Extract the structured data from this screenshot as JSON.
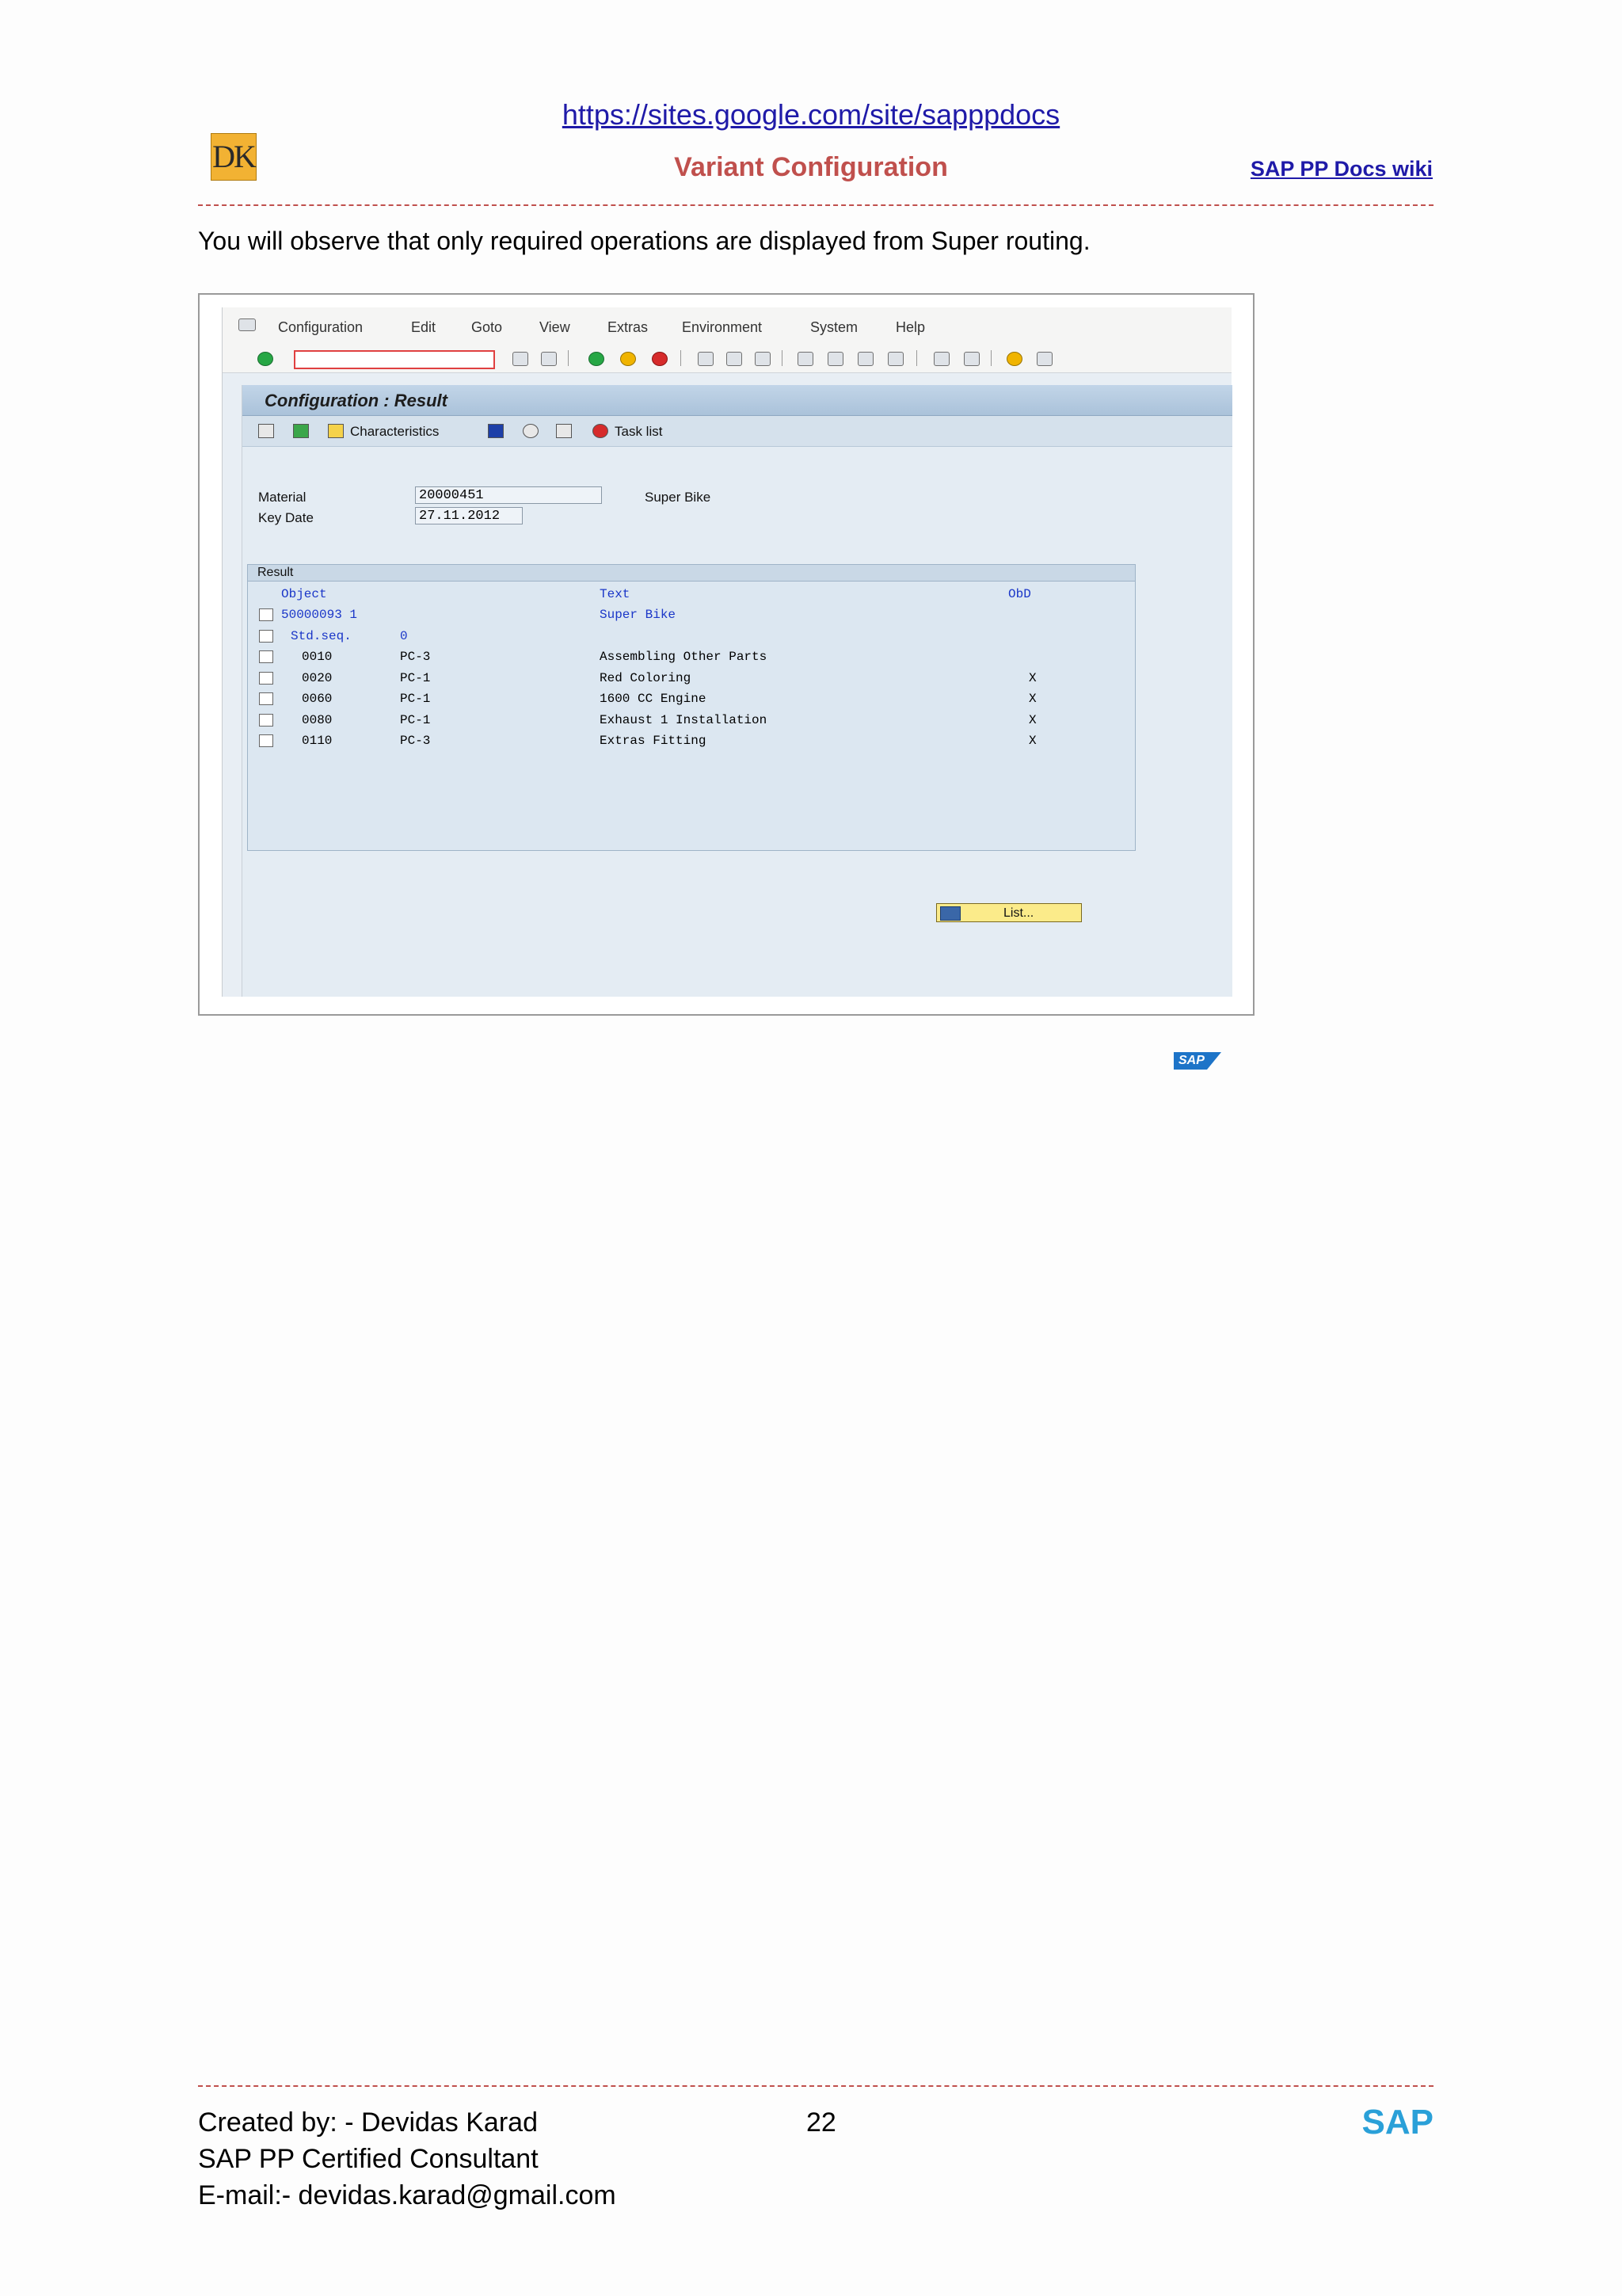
{
  "header": {
    "url": "https://sites.google.com/site/sapppdocs",
    "logo_text": "DK",
    "title": "Variant Configuration",
    "wiki_link": "SAP PP Docs wiki"
  },
  "intro": "You will observe that only required operations are displayed from Super routing.",
  "sap": {
    "menu": [
      "Configuration",
      "Edit",
      "Goto",
      "View",
      "Extras",
      "Environment",
      "System",
      "Help"
    ],
    "screen_title": "Configuration : Result",
    "app_toolbar": {
      "characteristics": "Characteristics",
      "task_list": "Task list"
    },
    "fields": {
      "material_label": "Material",
      "material_value": "20000451",
      "material_desc": "Super Bike",
      "keydate_label": "Key Date",
      "keydate_value": "27.11.2012"
    },
    "result": {
      "title": "Result",
      "headers": {
        "object": "Object",
        "text": "Text",
        "obd": "ObD"
      },
      "rows": [
        {
          "object": "50000093 1",
          "plant": "",
          "text": "Super Bike",
          "obd": "",
          "blue": true
        },
        {
          "object": "Std.seq.",
          "plant": "0",
          "text": "",
          "obd": "",
          "blue": true
        },
        {
          "object": "0010",
          "plant": "PC-3",
          "text": "Assembling Other Parts",
          "obd": "",
          "blue": false
        },
        {
          "object": "0020",
          "plant": "PC-1",
          "text": "Red Coloring",
          "obd": "X",
          "blue": false
        },
        {
          "object": "0060",
          "plant": "PC-1",
          "text": "1600 CC Engine",
          "obd": "X",
          "blue": false
        },
        {
          "object": "0080",
          "plant": "PC-1",
          "text": "Exhaust 1 Installation",
          "obd": "X",
          "blue": false
        },
        {
          "object": "0110",
          "plant": "PC-3",
          "text": "Extras Fitting",
          "obd": "X",
          "blue": false
        }
      ]
    },
    "list_button": "List...",
    "sap_logo": "SAP"
  },
  "footer": {
    "created_by": "Created by: - Devidas Karad",
    "page": "22",
    "role": "SAP PP Certified Consultant",
    "email": "E-mail:- devidas.karad@gmail.com",
    "brand": "SAP"
  }
}
